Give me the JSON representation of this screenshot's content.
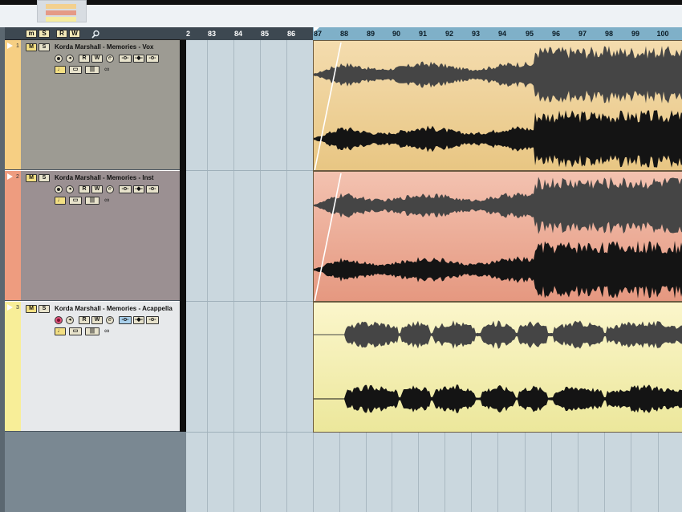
{
  "ruler": {
    "bars": [
      "2",
      "83",
      "84",
      "85",
      "86",
      "87",
      "88",
      "89",
      "90",
      "91",
      "92",
      "93",
      "94",
      "95",
      "96",
      "97",
      "98",
      "99",
      "100"
    ]
  },
  "toolbar": {
    "m_label": "m",
    "s_label": "S",
    "r_label": "R",
    "w_label": "W",
    "search_icon": "search-icon"
  },
  "tracks": [
    {
      "number": "1",
      "name": "Korda Marshall - Memories - Vox",
      "color": "#f6cf83",
      "panel_color": "#9d9b93",
      "event_top": "#f4dcae",
      "event_bottom": "#e8c683",
      "record_armed": false
    },
    {
      "number": "2",
      "name": "Korda Marshall - Memories - Inst",
      "color": "#ee9c7f",
      "panel_color": "#9b9092",
      "event_top": "#f3c2b0",
      "event_bottom": "#e59880",
      "record_armed": false
    },
    {
      "number": "3",
      "name": "Korda Marshall - Memories - Acappella",
      "color": "#f8ee98",
      "panel_color": "#e7e9eb",
      "event_top": "#fbf6cb",
      "event_bottom": "#ece79b",
      "record_armed": true
    }
  ],
  "buttons": {
    "mute": "M",
    "solo": "S",
    "read": "R",
    "write": "W",
    "edit": "e"
  },
  "colors": {
    "ruler_active": "#7fb0c8",
    "project_bg": "#cad7de",
    "divider": "#0e0e0e"
  }
}
